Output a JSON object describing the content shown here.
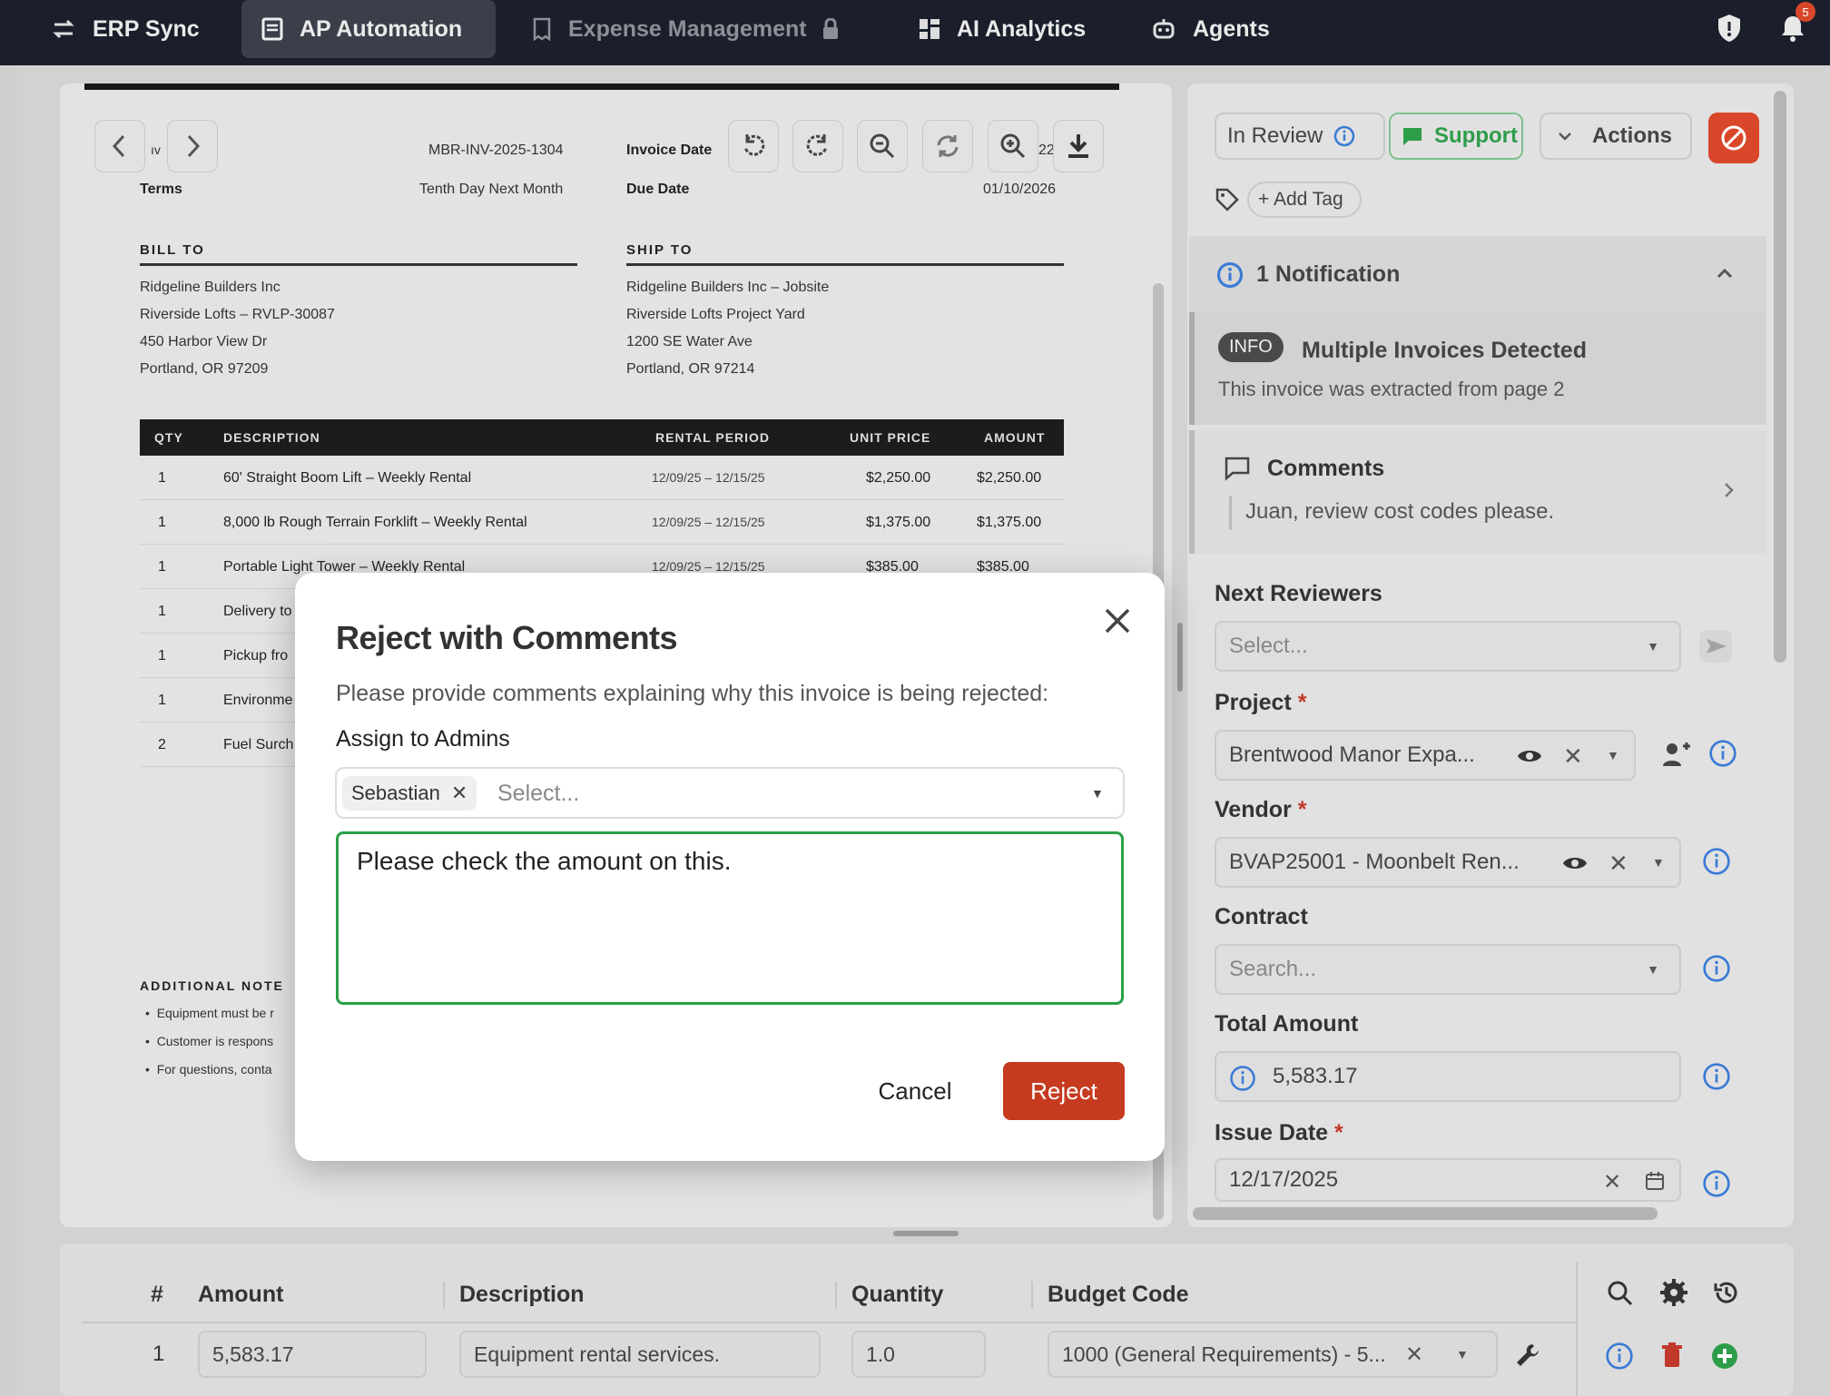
{
  "nav": {
    "tabs": [
      {
        "label": "ERP Sync"
      },
      {
        "label": "AP Automation"
      },
      {
        "label": "Expense Management"
      },
      {
        "label": "AI Analytics"
      },
      {
        "label": "Agents"
      }
    ],
    "notification_count": "5"
  },
  "invoice": {
    "number_label": "ıv",
    "number": "MBR-INV-2025-1304",
    "invoice_date_label": "Invoice Date",
    "invoice_date_partial": "22",
    "terms_label": "Terms",
    "terms": "Tenth Day Next Month",
    "due_date_label": "Due Date",
    "due_date": "01/10/2026",
    "bill_to_label": "BILL TO",
    "bill_to": [
      "Ridgeline Builders Inc",
      "Riverside Lofts – RVLP-30087",
      "450 Harbor View Dr",
      "Portland, OR 97209"
    ],
    "ship_to_label": "SHIP TO",
    "ship_to": [
      "Ridgeline Builders Inc – Jobsite",
      "Riverside Lofts Project Yard",
      "1200 SE Water Ave",
      "Portland, OR 97214"
    ],
    "columns": [
      "QTY",
      "DESCRIPTION",
      "RENTAL PERIOD",
      "UNIT PRICE",
      "AMOUNT"
    ],
    "rows": [
      {
        "qty": "1",
        "desc": "60' Straight Boom Lift – Weekly Rental",
        "period": "12/09/25 – 12/15/25",
        "unit": "$2,250.00",
        "amount": "$2,250.00"
      },
      {
        "qty": "1",
        "desc": "8,000 lb Rough Terrain Forklift – Weekly Rental",
        "period": "12/09/25 – 12/15/25",
        "unit": "$1,375.00",
        "amount": "$1,375.00"
      },
      {
        "qty": "1",
        "desc": "Portable Light Tower – Weekly Rental",
        "period": "12/09/25 – 12/15/25",
        "unit": "$385.00",
        "amount": "$385.00"
      },
      {
        "qty": "1",
        "desc": "Delivery to",
        "period": "",
        "unit": "",
        "amount": ""
      },
      {
        "qty": "1",
        "desc": "Pickup fro",
        "period": "",
        "unit": "",
        "amount": ""
      },
      {
        "qty": "1",
        "desc": "Environme",
        "period": "",
        "unit": "",
        "amount": ""
      },
      {
        "qty": "2",
        "desc": "Fuel Surch",
        "period": "",
        "unit": "",
        "amount": ""
      }
    ],
    "notes_label": "ADDITIONAL NOTE",
    "notes": [
      "Equipment must be r",
      "Customer is respons",
      "For questions, conta"
    ]
  },
  "sidebar": {
    "status": "In Review",
    "support_label": "Support",
    "actions_label": "Actions",
    "add_tag_label": "+ Add Tag",
    "notification_header": "1 Notification",
    "notification_badge": "INFO",
    "notification_title": "Multiple Invoices Detected",
    "notification_text": "This invoice was extracted from page 2",
    "comments_title": "Comments",
    "comments_text": "Juan, review cost codes please.",
    "next_reviewers_label": "Next Reviewers",
    "next_reviewers_placeholder": "Select...",
    "project_label": "Project",
    "project_value": "Brentwood Manor Expa...",
    "vendor_label": "Vendor",
    "vendor_value": "BVAP25001 - Moonbelt Ren...",
    "contract_label": "Contract",
    "contract_placeholder": "Search...",
    "total_amount_label": "Total Amount",
    "total_amount_value": "5,583.17",
    "issue_date_label": "Issue Date",
    "issue_date_value": "12/17/2025",
    "required_mark": "*"
  },
  "lines": {
    "columns": [
      "#",
      "Amount",
      "Description",
      "Quantity",
      "Budget Code"
    ],
    "row": {
      "num": "1",
      "amount": "5,583.17",
      "description": "Equipment rental services.",
      "quantity": "1.0",
      "budget_code": "1000 (General Requirements) - 5..."
    }
  },
  "modal": {
    "title": "Reject with Comments",
    "description": "Please provide comments explaining why this invoice is being rejected:",
    "assign_label": "Assign to Admins",
    "selected_admin": "Sebastian",
    "assign_placeholder": "Select...",
    "comment_value": "Please check the amount on this. ",
    "cancel_label": "Cancel",
    "reject_label": "Reject"
  },
  "colors": {
    "nav_bg": "#1a1f2b",
    "reject_red": "#c63a20",
    "focus_green": "#2aa047",
    "support_green": "#2e9d4a",
    "info_blue": "#3a7bd5"
  }
}
